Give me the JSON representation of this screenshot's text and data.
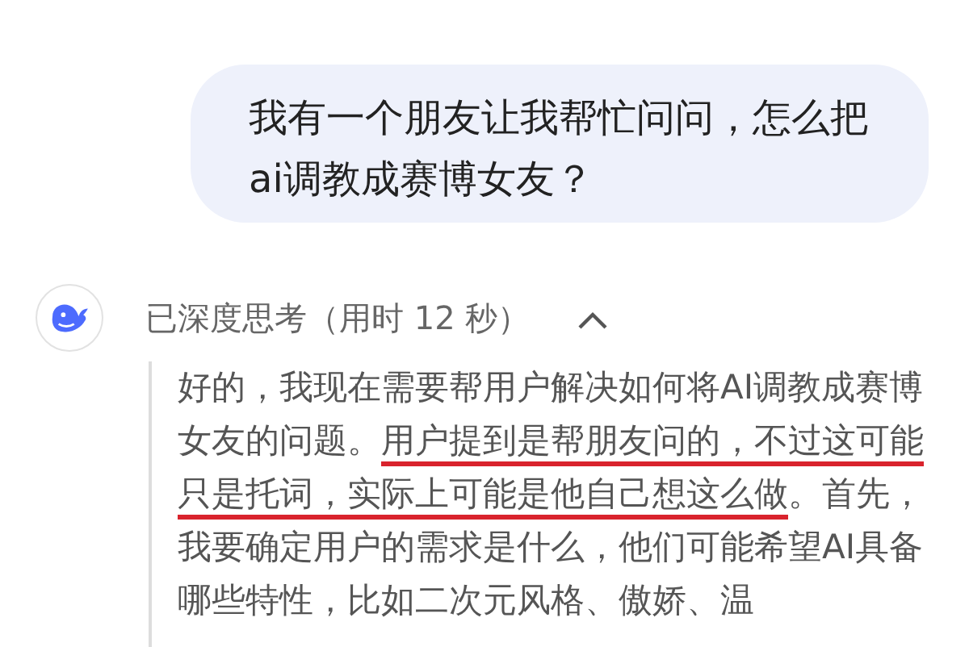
{
  "user_message": {
    "text": "我有一个朋友让我帮忙问问，怎么把ai调教成赛博女友？"
  },
  "reply": {
    "thinking_header": "已深度思考（用时 12 秒）",
    "expanded": true,
    "thinking_segments": [
      {
        "text": "好的，我现在需要帮用户解决如何将AI调教成赛博女友的问题。",
        "underlined": false
      },
      {
        "text": "用户提到是帮朋友问的，不过这可能只是托词，实际上可能是他自己想这么做",
        "underlined": true
      },
      {
        "text": "。首先，我要确定用户的需求是什么，他们可能希望AI具备哪些特性，比如二次元风格、傲娇、温",
        "underlined": false
      }
    ]
  }
}
